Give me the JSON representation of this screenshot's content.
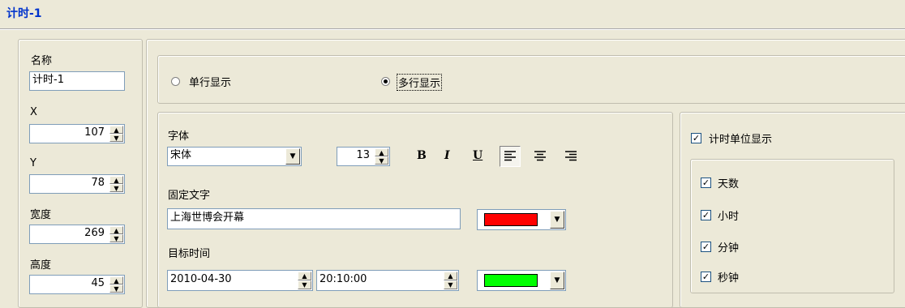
{
  "window": {
    "title": "计时-1"
  },
  "left_panel": {
    "name_label": "名称",
    "name_value": "计时-1",
    "x_label": "X",
    "x_value": "107",
    "y_label": "Y",
    "y_value": "78",
    "width_label": "宽度",
    "width_value": "269",
    "height_label": "高度",
    "height_value": "45"
  },
  "display_mode": {
    "single_label": "单行显示",
    "multi_label": "多行显示",
    "selected": "multi"
  },
  "font": {
    "label": "字体",
    "family": "宋体",
    "size": "13",
    "bold": "B",
    "italic": "I",
    "underline": "U"
  },
  "fixed_text": {
    "label": "固定文字",
    "value": "上海世博会开幕",
    "color": "#ff0000"
  },
  "target_time": {
    "label": "目标时间",
    "date": "2010-04-30",
    "time": "20:10:00",
    "color": "#00ff00"
  },
  "units": {
    "show_label": "计时单位显示",
    "show_checked": true,
    "days": "天数",
    "hours": "小时",
    "minutes": "分钟",
    "seconds": "秒钟"
  }
}
